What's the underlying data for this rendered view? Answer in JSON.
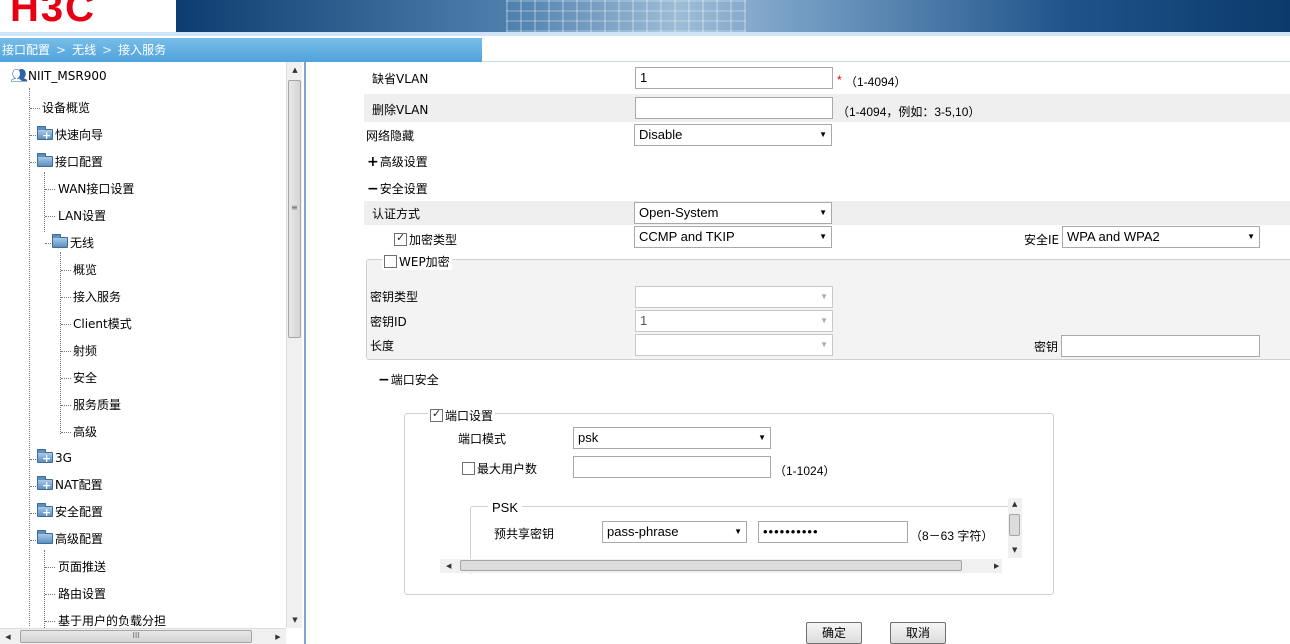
{
  "brand": {
    "logo_text": "H3C"
  },
  "breadcrumb": [
    "接口配置",
    "无线",
    "接入服务"
  ],
  "breadcrumb_sep": ">",
  "tree": {
    "root": "NIIT_MSR900",
    "items": [
      {
        "label": "设备概览",
        "level": 1,
        "type": "leaf"
      },
      {
        "label": "快速向导",
        "level": 1,
        "type": "folder-closed"
      },
      {
        "label": "接口配置",
        "level": 1,
        "type": "folder-open"
      },
      {
        "label": "WAN接口设置",
        "level": 2,
        "type": "leaf"
      },
      {
        "label": "LAN设置",
        "level": 2,
        "type": "leaf"
      },
      {
        "label": "无线",
        "level": 2,
        "type": "folder-open"
      },
      {
        "label": "概览",
        "level": 3,
        "type": "leaf"
      },
      {
        "label": "接入服务",
        "level": 3,
        "type": "leaf"
      },
      {
        "label": "Client模式",
        "level": 3,
        "type": "leaf"
      },
      {
        "label": "射频",
        "level": 3,
        "type": "leaf"
      },
      {
        "label": "安全",
        "level": 3,
        "type": "leaf"
      },
      {
        "label": "服务质量",
        "level": 3,
        "type": "leaf"
      },
      {
        "label": "高级",
        "level": 3,
        "type": "leaf"
      },
      {
        "label": "3G",
        "level": 1,
        "type": "folder-closed"
      },
      {
        "label": "NAT配置",
        "level": 1,
        "type": "folder-closed"
      },
      {
        "label": "安全配置",
        "level": 1,
        "type": "folder-closed"
      },
      {
        "label": "高级配置",
        "level": 1,
        "type": "folder-open"
      },
      {
        "label": "页面推送",
        "level": 2,
        "type": "leaf"
      },
      {
        "label": "路由设置",
        "level": 2,
        "type": "leaf"
      },
      {
        "label": "基于用户的负载分担",
        "level": 2,
        "type": "leaf"
      }
    ]
  },
  "form": {
    "default_vlan": {
      "label": "缺省VLAN",
      "value": "1",
      "required_mark": "*",
      "hint": "（1-4094）"
    },
    "delete_vlan": {
      "label": "删除VLAN",
      "value": "",
      "hint": "（1-4094，例如：3-5,10）"
    },
    "network_hide": {
      "label": "网络隐藏",
      "value": "Disable"
    },
    "advanced_toggle": {
      "symbol": "+",
      "label": "高级设置"
    },
    "security_toggle": {
      "symbol": "−",
      "label": "安全设置"
    },
    "auth_method": {
      "label": "认证方式",
      "value": "Open-System"
    },
    "cipher_type": {
      "label": "加密类型",
      "checked": true,
      "value": "CCMP and TKIP"
    },
    "security_ie": {
      "label": "安全IE",
      "value": "WPA and WPA2"
    },
    "wep": {
      "label": "WEP加密",
      "checked": false
    },
    "key_type": {
      "label": "密钥类型",
      "value": ""
    },
    "key_id": {
      "label": "密钥ID",
      "value": "1"
    },
    "key_length": {
      "label": "长度",
      "value": ""
    },
    "key": {
      "label": "密钥",
      "value": ""
    },
    "port_security_toggle": {
      "symbol": "−",
      "label": "端口安全"
    },
    "port_settings": {
      "label": "端口设置",
      "checked": true
    },
    "port_mode": {
      "label": "端口模式",
      "value": "psk"
    },
    "max_users": {
      "label": "最大用户数",
      "checked": false,
      "value": "",
      "hint": "（1-1024）"
    },
    "psk": {
      "legend": "PSK",
      "label": "预共享密钥",
      "format": "pass-phrase",
      "value": "••••••••••",
      "hint": "（8－63 字符）"
    }
  },
  "buttons": {
    "ok": "确定",
    "cancel": "取消"
  },
  "icons": {
    "root": "users-icon",
    "folder": "folder-icon",
    "dropdown": "chevron-down-icon"
  }
}
